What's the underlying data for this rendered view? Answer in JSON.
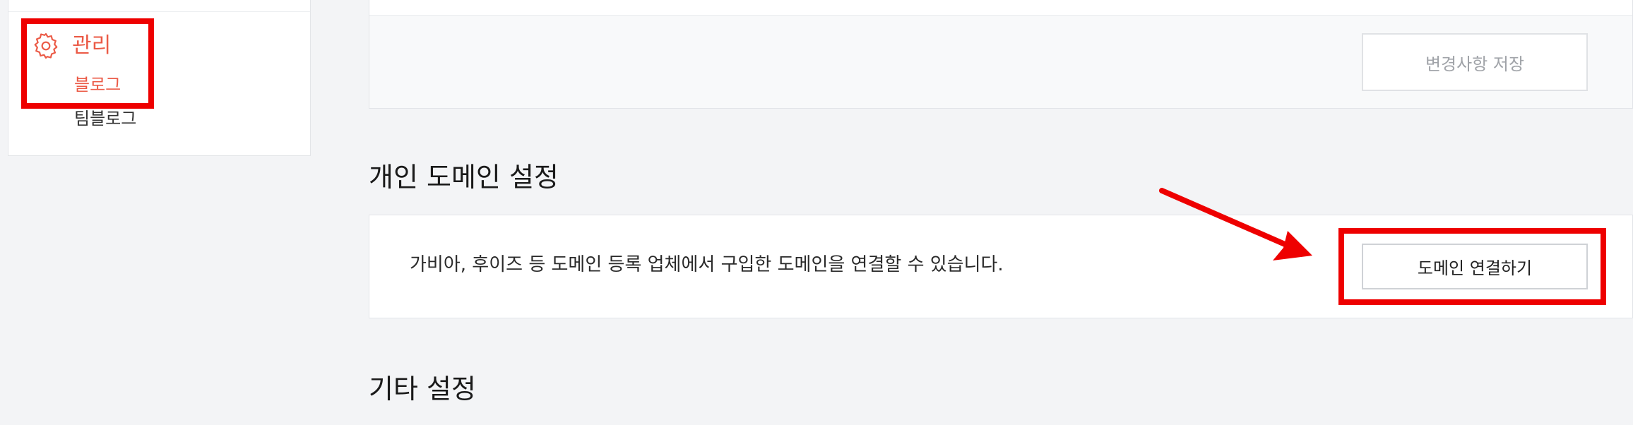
{
  "sidebar": {
    "group": {
      "icon": "gear-icon",
      "label": "관리"
    },
    "items": [
      {
        "label": "블로그",
        "active": true
      },
      {
        "label": "팀블로그",
        "active": false
      }
    ]
  },
  "top_panel": {
    "save_button_label": "변경사항 저장"
  },
  "domain_section": {
    "title": "개인 도메인 설정",
    "description": "가비아, 후이즈 등 도메인 등록 업체에서 구입한 도메인을 연결할 수 있습니다.",
    "connect_button_label": "도메인 연결하기"
  },
  "other_section": {
    "title": "기타 설정"
  },
  "colors": {
    "accent": "#eb5a46",
    "annotation_red": "#ee0000",
    "page_background": "#f3f4f6"
  }
}
